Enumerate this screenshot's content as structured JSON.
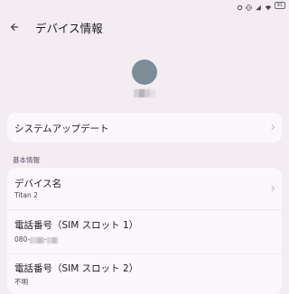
{
  "status_bar": {
    "battery_label": "91",
    "icons": [
      "sync-icon",
      "vibrate-icon",
      "signal-icon",
      "wifi-icon",
      "battery-icon"
    ]
  },
  "app_bar": {
    "back_icon": "arrow-back-icon",
    "title": "デバイス情報"
  },
  "header": {
    "avatar_color": "#7c8d98"
  },
  "system_update": {
    "label": "システムアップデート"
  },
  "basic_info": {
    "section_label": "基本情報",
    "device_name": {
      "label": "デバイス名",
      "value": "Titan 2"
    },
    "phone_slot1": {
      "label": "電話番号（SIM スロット 1）",
      "value_prefix": "080-",
      "value_sep": "-"
    },
    "phone_slot2": {
      "label": "電話番号（SIM スロット 2）",
      "value": "不明"
    }
  },
  "colors": {
    "background": "#f3edf2",
    "card": "#fbf8fd",
    "avatar": "#7c8d98"
  }
}
